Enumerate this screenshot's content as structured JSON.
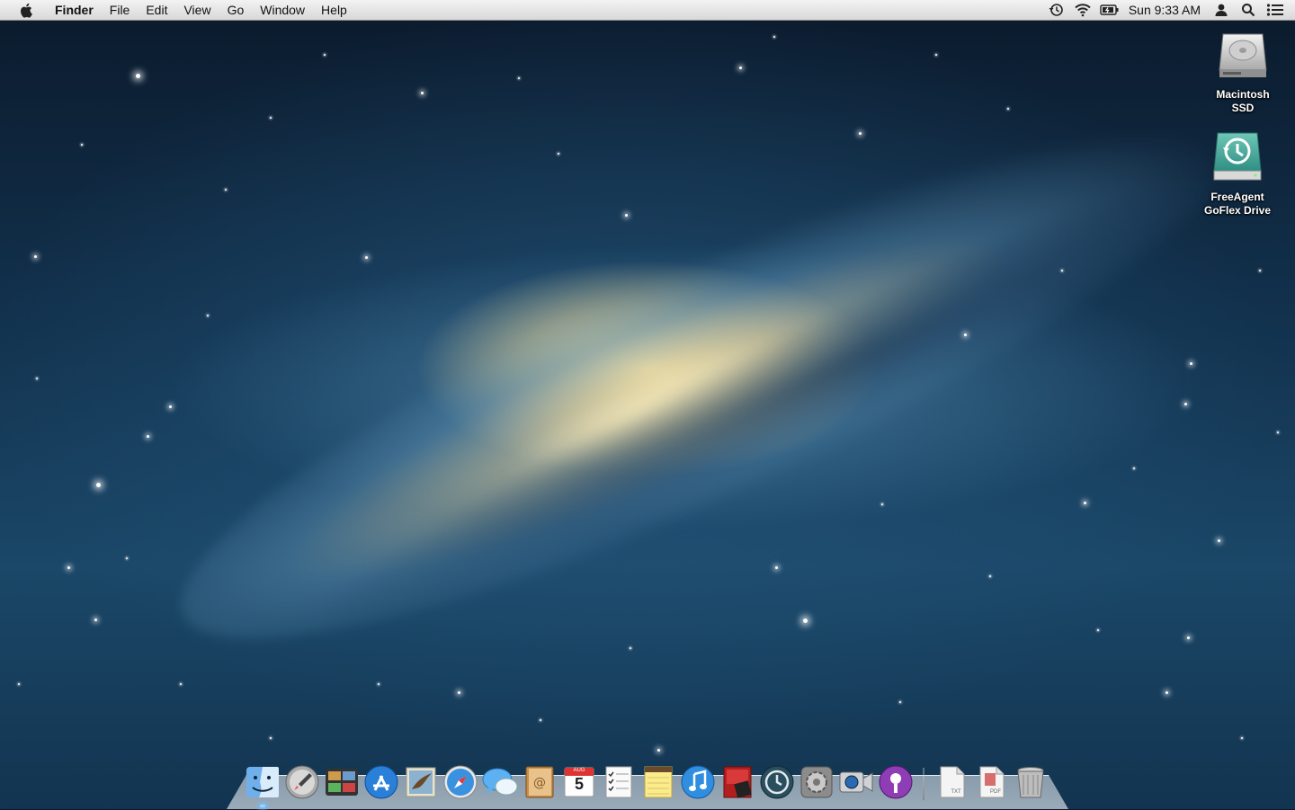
{
  "menubar": {
    "apple_icon": "apple-logo-icon",
    "app_name": "Finder",
    "menus": [
      "File",
      "Edit",
      "View",
      "Go",
      "Window",
      "Help"
    ],
    "status_icons": [
      "time-machine-icon",
      "wifi-icon",
      "battery-icon"
    ],
    "clock": "Sun 9:33 AM",
    "right_icons": [
      "user-icon",
      "spotlight-search-icon",
      "notification-center-icon"
    ]
  },
  "desktop": {
    "icons": [
      {
        "label_line1": "Macintosh",
        "label_line2": "SSD",
        "icon": "hard-drive-icon"
      },
      {
        "label_line1": "FreeAgent",
        "label_line2": "GoFlex Drive",
        "icon": "time-machine-drive-icon"
      }
    ]
  },
  "dock": {
    "apps": [
      {
        "name": "Finder",
        "icon": "finder-icon"
      },
      {
        "name": "Launchpad",
        "icon": "launchpad-icon"
      },
      {
        "name": "Mission Control",
        "icon": "mission-control-icon"
      },
      {
        "name": "App Store",
        "icon": "app-store-icon"
      },
      {
        "name": "Mail",
        "icon": "mail-icon"
      },
      {
        "name": "Safari",
        "icon": "safari-icon"
      },
      {
        "name": "Messages",
        "icon": "messages-icon"
      },
      {
        "name": "Contacts",
        "icon": "contacts-icon"
      },
      {
        "name": "Calendar",
        "icon": "calendar-icon",
        "month": "AUG",
        "day": "5"
      },
      {
        "name": "Reminders",
        "icon": "reminders-icon"
      },
      {
        "name": "Notes",
        "icon": "notes-icon"
      },
      {
        "name": "iTunes",
        "icon": "itunes-icon"
      },
      {
        "name": "Photo Booth",
        "icon": "photo-booth-icon"
      },
      {
        "name": "Time Machine",
        "icon": "time-machine-icon"
      },
      {
        "name": "System Preferences",
        "icon": "system-preferences-icon"
      },
      {
        "name": "FaceTime",
        "icon": "facetime-icon"
      },
      {
        "name": "Podcast Capture",
        "icon": "podcast-icon"
      }
    ],
    "stacks": [
      {
        "name": "Documents",
        "icon": "txt-document-icon",
        "badge": "TXT"
      },
      {
        "name": "Downloads",
        "icon": "pdf-document-icon",
        "badge": "PDF"
      },
      {
        "name": "Trash",
        "icon": "trash-icon"
      }
    ]
  }
}
